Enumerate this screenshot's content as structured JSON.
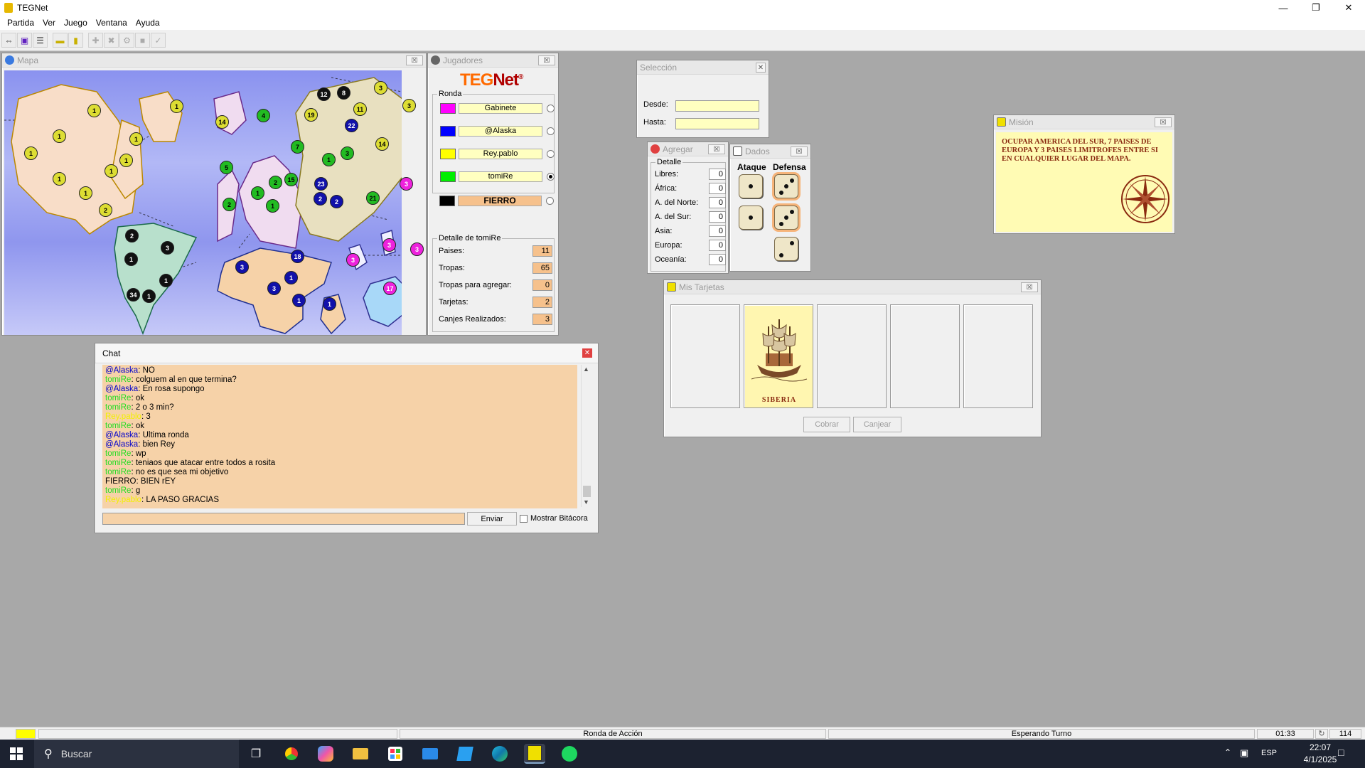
{
  "app": {
    "title": "TEGNet"
  },
  "menu": [
    "Partida",
    "Ver",
    "Juego",
    "Ventana",
    "Ayuda"
  ],
  "toolbar_icons": [
    "connect-icon",
    "dice-icon",
    "list-icon",
    "window-icon",
    "card-icon",
    "add-icon",
    "cancel-icon",
    "gear-icon",
    "stop-icon",
    "check-icon"
  ],
  "map_window": {
    "title": "Mapa",
    "markers": [
      {
        "label": "1",
        "player": "Rey.pablo"
      },
      {
        "label": "1",
        "player": "Rey.pablo"
      },
      {
        "label": "1",
        "player": "Rey.pablo"
      },
      {
        "label": "1",
        "player": "Rey.pablo"
      },
      {
        "label": "1",
        "player": "Rey.pablo"
      },
      {
        "label": "1",
        "player": "Rey.pablo"
      },
      {
        "label": "1",
        "player": "Rey.pablo"
      },
      {
        "label": "1",
        "player": "Rey.pablo"
      },
      {
        "label": "1",
        "player": "Rey.pablo"
      },
      {
        "label": "2",
        "player": "Rey.pablo"
      },
      {
        "label": "14",
        "player": "Rey.pablo"
      },
      {
        "label": "19",
        "player": "Rey.pablo"
      },
      {
        "label": "11",
        "player": "Rey.pablo"
      },
      {
        "label": "3",
        "player": "Rey.pablo"
      },
      {
        "label": "3",
        "player": "Rey.pablo"
      },
      {
        "label": "14",
        "player": "Rey.pablo"
      },
      {
        "label": "4",
        "player": "tomiRe"
      },
      {
        "label": "7",
        "player": "tomiRe"
      },
      {
        "label": "5",
        "player": "tomiRe"
      },
      {
        "label": "1",
        "player": "tomiRe"
      },
      {
        "label": "2",
        "player": "tomiRe"
      },
      {
        "label": "15",
        "player": "tomiRe"
      },
      {
        "label": "2",
        "player": "tomiRe"
      },
      {
        "label": "1",
        "player": "tomiRe"
      },
      {
        "label": "1",
        "player": "tomiRe"
      },
      {
        "label": "3",
        "player": "tomiRe"
      },
      {
        "label": "21",
        "player": "tomiRe"
      },
      {
        "label": "22",
        "player": "@Alaska"
      },
      {
        "label": "23",
        "player": "@Alaska"
      },
      {
        "label": "2",
        "player": "@Alaska"
      },
      {
        "label": "2",
        "player": "@Alaska"
      },
      {
        "label": "3",
        "player": "@Alaska"
      },
      {
        "label": "18",
        "player": "@Alaska"
      },
      {
        "label": "1",
        "player": "@Alaska"
      },
      {
        "label": "3",
        "player": "@Alaska"
      },
      {
        "label": "1",
        "player": "@Alaska"
      },
      {
        "label": "1",
        "player": "@Alaska"
      },
      {
        "label": "12",
        "player": "FIERRO"
      },
      {
        "label": "8",
        "player": "FIERRO"
      },
      {
        "label": "2",
        "player": "FIERRO"
      },
      {
        "label": "3",
        "player": "FIERRO"
      },
      {
        "label": "1",
        "player": "FIERRO"
      },
      {
        "label": "1",
        "player": "FIERRO"
      },
      {
        "label": "34",
        "player": "FIERRO"
      },
      {
        "label": "1",
        "player": "FIERRO"
      },
      {
        "label": "3",
        "player": "Gabinete"
      },
      {
        "label": "3",
        "player": "Gabinete"
      },
      {
        "label": "3",
        "player": "Gabinete"
      },
      {
        "label": "3",
        "player": "Gabinete"
      },
      {
        "label": "17",
        "player": "Gabinete"
      }
    ]
  },
  "players_window": {
    "title": "Jugadores",
    "logo_a": "TEG",
    "logo_b": "Net",
    "logo_reg": "®",
    "round_label": "Ronda",
    "players": [
      {
        "name": "Gabinete",
        "color": "#ff00ff",
        "selected": false
      },
      {
        "name": "@Alaska",
        "color": "#0000ff",
        "selected": false
      },
      {
        "name": "Rey.pablo",
        "color": "#ffff00",
        "selected": false
      },
      {
        "name": "tomiRe",
        "color": "#00ee00",
        "selected": true
      },
      {
        "name": "FIERRO",
        "color": "#000000",
        "selected": false
      }
    ],
    "detail_label": "Detalle de tomiRe",
    "details": [
      {
        "label": "Paises:",
        "value": "11"
      },
      {
        "label": "Tropas:",
        "value": "65"
      },
      {
        "label": "Tropas para agregar:",
        "value": "0"
      },
      {
        "label": "Tarjetas:",
        "value": "2"
      },
      {
        "label": "Canjes Realizados:",
        "value": "3"
      }
    ]
  },
  "selection_window": {
    "title": "Selección",
    "from_label": "Desde:",
    "to_label": "Hasta:",
    "from_value": "",
    "to_value": ""
  },
  "add_window": {
    "title": "Agregar",
    "group_label": "Detalle",
    "rows": [
      {
        "label": "Libres:",
        "value": "0"
      },
      {
        "label": "África:",
        "value": "0"
      },
      {
        "label": "A. del Norte:",
        "value": "0"
      },
      {
        "label": "A. del Sur:",
        "value": "0"
      },
      {
        "label": "Asia:",
        "value": "0"
      },
      {
        "label": "Europa:",
        "value": "0"
      },
      {
        "label": "Oceanía:",
        "value": "0"
      }
    ]
  },
  "dice_window": {
    "title": "Dados",
    "attack_label": "Ataque",
    "defense_label": "Defensa",
    "attack": [
      1,
      1
    ],
    "defense": [
      3,
      3,
      2
    ]
  },
  "mission_window": {
    "title": "Misión",
    "text": "OCUPAR AMERICA DEL SUR, 7 PAISES DE EUROPA Y 3 PAISES LIMITROFES ENTRE SI EN CUALQUIER LUGAR DEL MAPA."
  },
  "cards_window": {
    "title": "Mis Tarjetas",
    "cards": [
      "",
      "SIBERIA",
      "",
      "",
      ""
    ],
    "collect_label": "Cobrar",
    "exchange_label": "Canjear"
  },
  "chat_window": {
    "title": "Chat",
    "messages": [
      {
        "from": "@Alaska",
        "cls": "a",
        "text": "NO"
      },
      {
        "from": "tomiRe",
        "cls": "t",
        "text": "colguem al en que termina?"
      },
      {
        "from": "@Alaska",
        "cls": "a",
        "text": "En rosa supongo"
      },
      {
        "from": "tomiRe",
        "cls": "t",
        "text": "ok"
      },
      {
        "from": "tomiRe",
        "cls": "t",
        "text": "2 o 3 min?"
      },
      {
        "from": "Rey.pablo",
        "cls": "r",
        "text": "3"
      },
      {
        "from": "tomiRe",
        "cls": "t",
        "text": "ok"
      },
      {
        "from": "@Alaska",
        "cls": "a",
        "text": "Ultima ronda"
      },
      {
        "from": "@Alaska",
        "cls": "a",
        "text": "bien Rey"
      },
      {
        "from": "tomiRe",
        "cls": "t",
        "text": "wp"
      },
      {
        "from": "tomiRe",
        "cls": "t",
        "text": "teniaos que atacar entre todos a rosita"
      },
      {
        "from": "tomiRe",
        "cls": "t",
        "text": "no es que sea mi objetivo"
      },
      {
        "from": "FIERRO",
        "cls": "f",
        "text": "BIEN rEY"
      },
      {
        "from": "tomiRe",
        "cls": "t",
        "text": "g"
      },
      {
        "from": "Rey.pablo",
        "cls": "r",
        "text": "LA PASO GRACIAS"
      }
    ],
    "input_value": "",
    "send_label": "Enviar",
    "log_label": "Mostrar Bitácora"
  },
  "status": {
    "phase": "Ronda de Acción",
    "state": "Esperando Turno",
    "time": "01:33",
    "count": "114"
  },
  "taskbar": {
    "search_placeholder": "Buscar",
    "lang": "ESP",
    "clock_time": "22:07",
    "clock_date": "4/1/2025"
  }
}
